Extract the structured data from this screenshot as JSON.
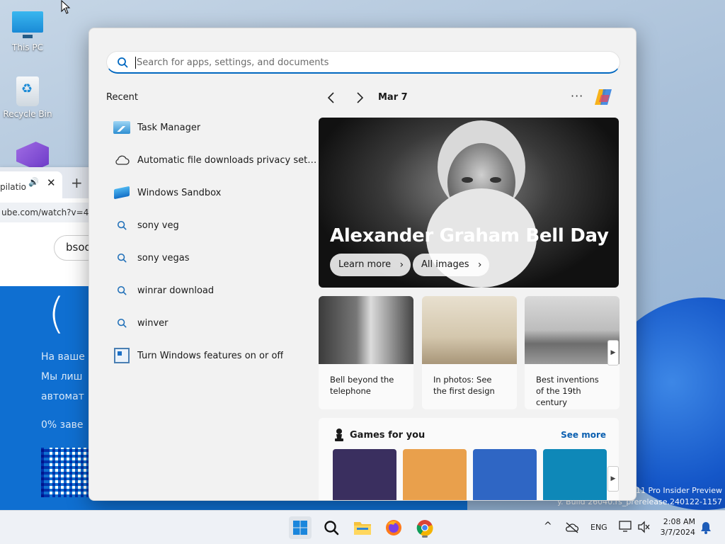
{
  "desktop": {
    "icons": [
      {
        "label": "This PC"
      },
      {
        "label": "Recycle Bin"
      }
    ],
    "watermark_line1": "11 Pro Insider Preview",
    "watermark_line2": "y. Build 26040.rs_prerelease.240122-1157"
  },
  "browser": {
    "tab_label": "pilatio",
    "url": "ube.com/watch?v=4",
    "search_value": "bsod"
  },
  "bsod": {
    "face": "(",
    "line1": "На ваше",
    "line2": "Мы лиш",
    "line3": "автомат",
    "progress": "0% заве"
  },
  "start": {
    "search": {
      "placeholder": "Search for apps, settings, and documents",
      "value": ""
    },
    "recent_title": "Recent",
    "recent_items": [
      {
        "label": "Task Manager",
        "icon": "task-manager-icon"
      },
      {
        "label": "Automatic file downloads privacy setti...",
        "icon": "cloud-icon"
      },
      {
        "label": "Windows Sandbox",
        "icon": "sandbox-icon"
      },
      {
        "label": "sony veg",
        "icon": "search-icon"
      },
      {
        "label": "sony vegas",
        "icon": "search-icon"
      },
      {
        "label": "winrar download",
        "icon": "search-icon"
      },
      {
        "label": "winver",
        "icon": "search-icon"
      },
      {
        "label": "Turn Windows features on or off",
        "icon": "windows-features-icon"
      }
    ],
    "date": "Mar 7",
    "hero": {
      "title": "Alexander Graham Bell Day",
      "learn_more": "Learn more",
      "all_images": "All images"
    },
    "cards": [
      {
        "text": "Bell beyond the telephone"
      },
      {
        "text": "In photos: See the first design"
      },
      {
        "text": "Best inventions of the 19th century"
      }
    ],
    "games": {
      "title": "Games for you",
      "see_more": "See more",
      "tile_colors": [
        "#3a2f5f",
        "#e9a04c",
        "#2f66c4",
        "#0e88b8"
      ]
    }
  },
  "taskbar": {
    "language": "ENG",
    "time": "2:08 AM",
    "date": "3/7/2024"
  },
  "colors": {
    "accent": "#0067c0",
    "link": "#0a5fb0",
    "bsod_blue": "#0f6fd1"
  }
}
